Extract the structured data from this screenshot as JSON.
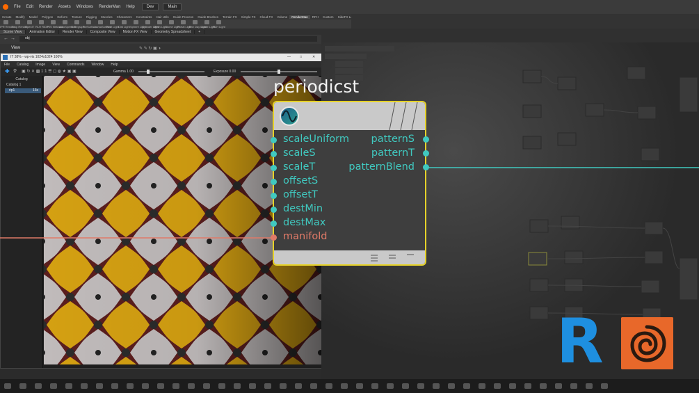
{
  "app_menu": [
    "File",
    "Edit",
    "Render",
    "Assets",
    "Windows",
    "RenderMan",
    "Help"
  ],
  "desktop_label": "Dev",
  "desktop2_label": "Main",
  "shelf_tabs": [
    "Create",
    "Modify",
    "Model",
    "Polygon",
    "Deform",
    "Texture",
    "Rigging",
    "Muscles",
    "Characters",
    "Constraints",
    "Hair Utils",
    "Guide Process",
    "Guide Brushes",
    "Terrain FX",
    "Simple FX",
    "Cloud FX",
    "Volume",
    "RenderMan",
    "RFH",
    "Custom",
    "SideFX Labs"
  ],
  "shelf_tools": [
    "IPR Render",
    "Stop Render",
    "OpenIT",
    "RLH RIDP",
    "RIS Network",
    "AutoSpeed R",
    "Nodegraph",
    "PxrSurface",
    "LamaSurface",
    "Rect Light",
    "Dist Light",
    "Sphere Light",
    "Cylinder Light",
    "Mesh Light",
    "Dome Light",
    "Portal Light",
    "Env Day Light",
    "Dome Light",
    "RLH Light"
  ],
  "pane_tabs": [
    "Scene View",
    "Animation Editor",
    "Render View",
    "Composite View",
    "Motion FX View",
    "Geometry Spreadsheet"
  ],
  "path": "obj",
  "view_label": "View",
  "it_window": {
    "title": "IT 38% - wp-vis 1024x1024 100%",
    "menu": [
      "File",
      "Catalog",
      "Image",
      "View",
      "Commands",
      "Window",
      "Help"
    ],
    "gamma_label": "Gamma  1.00",
    "exposure_label": "Exposure  0.00",
    "catalog_header": "Catalog",
    "catalog_item": "Catalog 1",
    "catalog_row_name": "rip1",
    "catalog_row_value": "13s"
  },
  "node": {
    "title": "periodicst",
    "inputs": [
      "scaleUniform",
      "scaleS",
      "scaleT",
      "offsetS",
      "offsetT",
      "destMin",
      "destMax",
      "manifold"
    ],
    "outputs": [
      "patternS",
      "patternT",
      "patternBlend"
    ]
  },
  "colors": {
    "port_teal": "#40c9c0",
    "port_manifold": "#e07a68",
    "node_border": "#e6d22a",
    "tile_yellow": "#d4a012",
    "renderman_blue": "#1e8fe0",
    "houdini_orange": "#ff6a00"
  },
  "logos": {
    "renderman_letter": "R"
  }
}
